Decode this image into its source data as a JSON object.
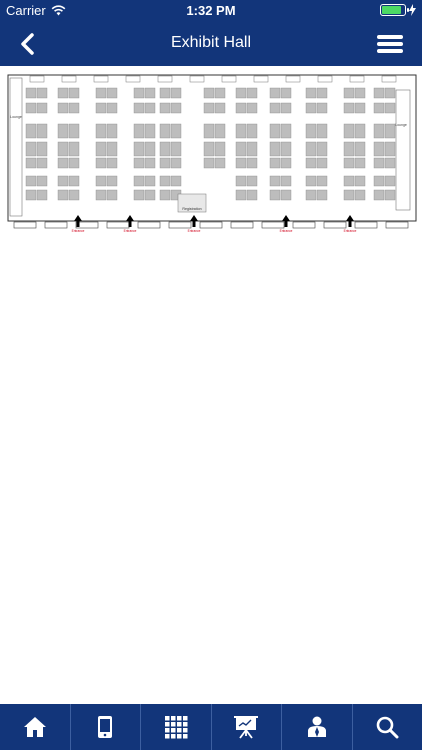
{
  "status_bar": {
    "carrier": "Carrier",
    "time": "1:32 PM",
    "battery_level": 0.85
  },
  "nav": {
    "title": "Exhibit Hall",
    "back_icon": "chevron-left-icon",
    "menu_icon": "hamburger-menu-icon"
  },
  "map": {
    "labels": {
      "lounge_left": "Lounge",
      "lounge_right": "Lounge",
      "registration": "Registration"
    },
    "entrance_label": "Entrance"
  },
  "tab_bar": {
    "items": [
      {
        "icon": "home-icon"
      },
      {
        "icon": "mobile-device-icon"
      },
      {
        "icon": "grid-qr-icon"
      },
      {
        "icon": "presentation-board-icon"
      },
      {
        "icon": "speaker-person-icon"
      },
      {
        "icon": "search-icon"
      }
    ]
  },
  "colors": {
    "primary": "#12357a",
    "battery": "#4cd964",
    "booth": "#bdbdbd",
    "entrance": "#d0021b"
  }
}
